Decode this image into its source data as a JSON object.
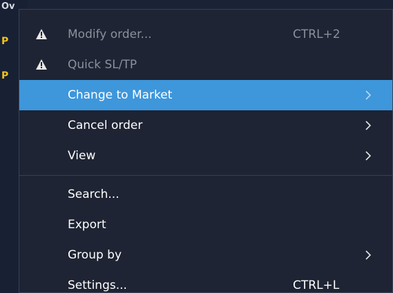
{
  "background": {
    "top_text": "Ov",
    "row_markers": [
      "P",
      "P"
    ]
  },
  "menu": {
    "items": [
      {
        "label": "Modify order...",
        "shortcut": "CTRL+2",
        "disabled": true,
        "icon": "warning-icon"
      },
      {
        "label": "Quick SL/TP",
        "shortcut": "",
        "disabled": true,
        "icon": "warning-icon"
      },
      {
        "label": "Change to Market",
        "submenu": true,
        "highlighted": true
      },
      {
        "label": "Cancel order",
        "submenu": true
      },
      {
        "label": "View",
        "submenu": true
      }
    ],
    "items2": [
      {
        "label": "Search..."
      },
      {
        "label": "Export"
      },
      {
        "label": "Group by",
        "submenu": true
      },
      {
        "label": "Settings...",
        "shortcut": "CTRL+L"
      }
    ]
  },
  "colors": {
    "menu_bg": "#1e2433",
    "highlight": "#3e96db",
    "disabled_text": "#8b909d",
    "accent_text": "#f0c419"
  }
}
